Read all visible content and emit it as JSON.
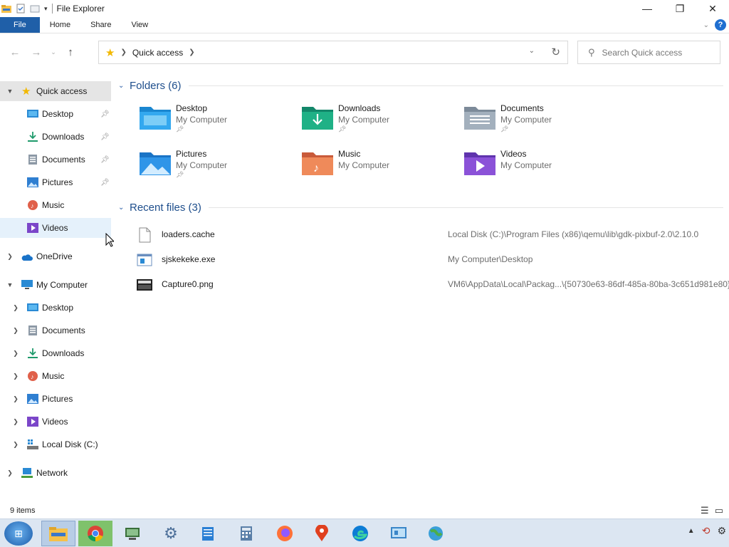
{
  "window": {
    "title": "File Explorer",
    "controls": {
      "minimize": "—",
      "maximize": "❐",
      "close": "✕"
    }
  },
  "ribbon": {
    "tabs": [
      "File",
      "Home",
      "Share",
      "View"
    ],
    "help": "?"
  },
  "address_bar": {
    "location": "Quick access",
    "search_placeholder": "Search Quick access"
  },
  "nav_pane": {
    "quick_access": {
      "label": "Quick access",
      "items": [
        {
          "label": "Desktop",
          "icon": "desktop-icon",
          "pinned": true
        },
        {
          "label": "Downloads",
          "icon": "downloads-icon",
          "pinned": true
        },
        {
          "label": "Documents",
          "icon": "documents-icon",
          "pinned": true
        },
        {
          "label": "Pictures",
          "icon": "pictures-icon",
          "pinned": true
        },
        {
          "label": "Music",
          "icon": "music-icon",
          "pinned": false
        },
        {
          "label": "Videos",
          "icon": "videos-icon",
          "pinned": false
        }
      ]
    },
    "onedrive": "OneDrive",
    "my_computer": {
      "label": "My Computer",
      "items": [
        {
          "label": "Desktop",
          "icon": "desktop-icon"
        },
        {
          "label": "Documents",
          "icon": "documents-icon"
        },
        {
          "label": "Downloads",
          "icon": "downloads-icon"
        },
        {
          "label": "Music",
          "icon": "music-icon"
        },
        {
          "label": "Pictures",
          "icon": "pictures-icon"
        },
        {
          "label": "Videos",
          "icon": "videos-icon"
        },
        {
          "label": "Local Disk (C:)",
          "icon": "drive-icon"
        }
      ]
    },
    "network": "Network"
  },
  "content": {
    "folders_header": "Folders (6)",
    "folders": [
      {
        "name": "Desktop",
        "location": "My Computer",
        "pinned": true,
        "icon": "desktop-folder-icon"
      },
      {
        "name": "Downloads",
        "location": "My Computer",
        "pinned": true,
        "icon": "downloads-folder-icon"
      },
      {
        "name": "Documents",
        "location": "My Computer",
        "pinned": true,
        "icon": "documents-folder-icon"
      },
      {
        "name": "Pictures",
        "location": "My Computer",
        "pinned": true,
        "icon": "pictures-folder-icon"
      },
      {
        "name": "Music",
        "location": "My Computer",
        "pinned": false,
        "icon": "music-folder-icon"
      },
      {
        "name": "Videos",
        "location": "My Computer",
        "pinned": false,
        "icon": "videos-folder-icon"
      }
    ],
    "recent_header": "Recent files (3)",
    "recent_files": [
      {
        "name": "loaders.cache",
        "path": "Local Disk (C:)\\Program Files (x86)\\qemu\\lib\\gdk-pixbuf-2.0\\2.10.0",
        "icon": "file-icon"
      },
      {
        "name": "sjskekeke.exe",
        "path": "My Computer\\Desktop",
        "icon": "exe-icon"
      },
      {
        "name": "Capture0.png",
        "path": "VM6\\AppData\\Local\\Packag...\\{50730e63-86df-485a-80ba-3c651d981e80}",
        "icon": "image-file-icon"
      }
    ]
  },
  "status_bar": {
    "items_count": "9 items"
  },
  "taskbar": {
    "apps": [
      "file-explorer-icon",
      "chrome-icon",
      "device-manager-icon",
      "settings-icon",
      "notepad-icon",
      "calculator-icon",
      "firefox-icon",
      "maps-icon",
      "edge-icon",
      "control-panel-icon",
      "network-globe-icon"
    ]
  },
  "colors": {
    "accent": "#1f5fa8",
    "header_text": "#1e4e8c",
    "selection": "#e5e5e5",
    "hover": "#e5f1fb"
  }
}
